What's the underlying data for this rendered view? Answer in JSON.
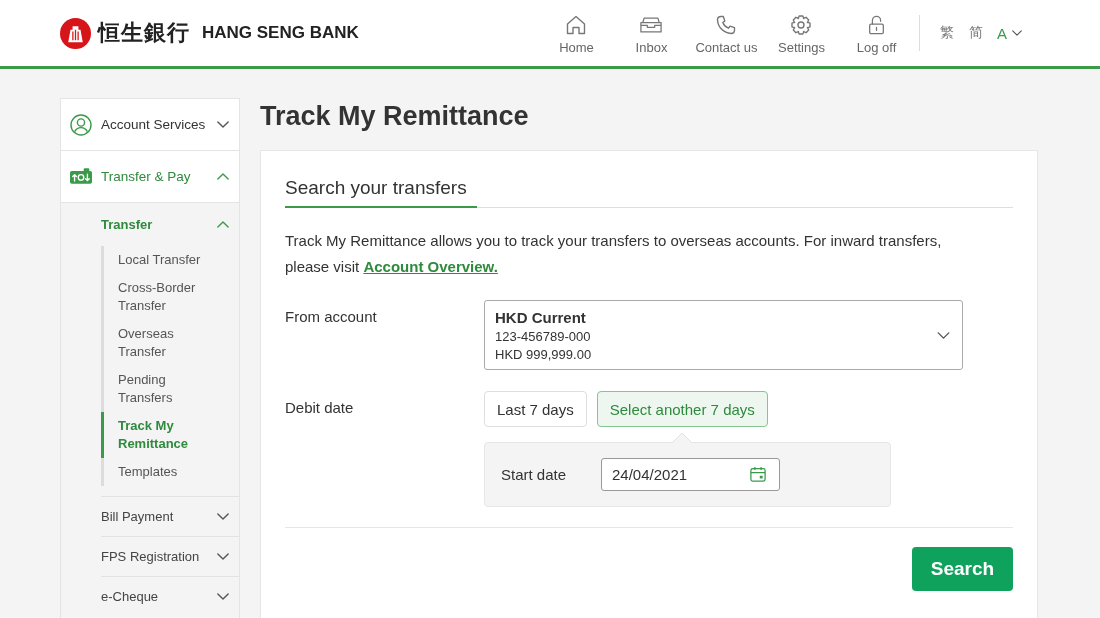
{
  "header": {
    "logo": {
      "chinese": "恒生銀行",
      "english": "HANG SENG BANK"
    },
    "nav": [
      {
        "kind": "home",
        "label": "Home"
      },
      {
        "kind": "inbox",
        "label": "Inbox"
      },
      {
        "kind": "contact",
        "label": "Contact us"
      },
      {
        "kind": "settings",
        "label": "Settings"
      },
      {
        "kind": "logoff",
        "label": "Log off"
      }
    ],
    "languages": [
      {
        "label": "繁"
      },
      {
        "label": "简"
      }
    ],
    "text_size": {
      "label": "A"
    }
  },
  "sidebar": {
    "sections": [
      {
        "kind": "account",
        "label": "Account Services",
        "expanded": false
      },
      {
        "kind": "payments",
        "label": "Transfer & Pay",
        "expanded": true,
        "children": [
          {
            "label": "Transfer",
            "expanded": true,
            "children": [
              {
                "label": "Local Transfer",
                "selected": false
              },
              {
                "label": "Cross-Border Transfer",
                "selected": false
              },
              {
                "label": "Overseas Transfer",
                "selected": false
              },
              {
                "label": "Pending Transfers",
                "selected": false
              },
              {
                "label": "Track My Remittance",
                "selected": true
              },
              {
                "label": "Templates",
                "selected": false
              }
            ]
          },
          {
            "label": "Bill Payment",
            "expanded": false
          },
          {
            "label": "FPS Registration",
            "expanded": false
          },
          {
            "label": "e-Cheque",
            "expanded": false
          }
        ]
      }
    ]
  },
  "page_title": "Track My Remittance",
  "form": {
    "heading": "Search your transfers",
    "intro": "Track My Remittance allows you to track your transfers to overseas accounts. For inward transfers, please visit",
    "intro_link": "Account Overview.",
    "from_account": {
      "label": "From account",
      "name": "HKD Current",
      "number": "123-456789-000",
      "balance": "HKD 999,999.00"
    },
    "debit_date": {
      "label": "Debit date",
      "options": [
        {
          "label": "Last 7 days",
          "selected": false
        },
        {
          "label": "Select another 7 days",
          "selected": true
        }
      ],
      "start_date": {
        "label": "Start date",
        "value": "24/04/2021"
      }
    },
    "search_button": "Search"
  }
}
